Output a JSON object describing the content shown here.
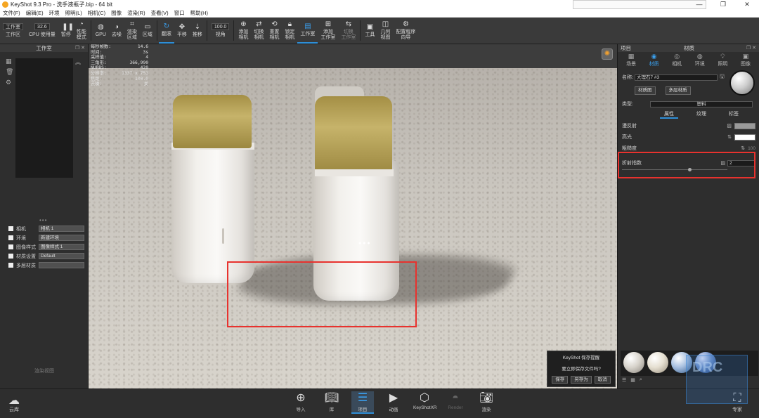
{
  "titlebar": {
    "title": "KeyShot 9.3 Pro - 洗手液瓶子.bip - 64 bit",
    "minimize": "—",
    "maximize": "❐",
    "close": "✕"
  },
  "menu": [
    "文件(F)",
    "编辑(E)",
    "环境",
    "照明(L)",
    "相机(C)",
    "图像",
    "渲染(R)",
    "查看(V)",
    "窗口",
    "帮助(H)"
  ],
  "toolbar": {
    "workspace_value": "工作室",
    "workspace_label": "工作区",
    "cpu_value": "32.6",
    "cpu_label": "CPU 使用量",
    "pause": "暂停",
    "perf_mode": "性能\n模式",
    "gpu": "GPU",
    "denoise": "去噪",
    "render_region": "渲染\n区域",
    "region": "区域",
    "tumble": "翻滚",
    "pan": "平移",
    "dolly": "推移",
    "fov_value": "100.0",
    "fov_label": "视角",
    "add_camera": "添加\n相机",
    "switch_camera": "切换\n相机",
    "reset_camera": "重置\n相机",
    "lock_camera": "锁定\n相机",
    "studio": "工作室",
    "add_studio": "添加\n工作室",
    "switch_studio": "切换\n工作室",
    "tools": "工具",
    "geometry_view": "几何\n视图",
    "config_wizard": "配置程序\n向导"
  },
  "left_panel": {
    "title": "工作室",
    "rows": [
      {
        "label": "相机",
        "value": "相机 1"
      },
      {
        "label": "环境",
        "value": "新建环境"
      },
      {
        "label": "图像样式",
        "value": "图像样式 1"
      },
      {
        "label": "材质设置",
        "value": "Default"
      },
      {
        "label": "多层材质",
        "value": ""
      }
    ],
    "footer": "渲染视图"
  },
  "stats": [
    {
      "k": "每秒帧数:",
      "v": "14.6"
    },
    {
      "k": "时间:",
      "v": "3s"
    },
    {
      "k": "采样值:",
      "v": "4"
    },
    {
      "k": "三角形:",
      "v": "366,990"
    },
    {
      "k": "NURBS:",
      "v": "420"
    },
    {
      "k": "分辨率:",
      "v": "1337 x 753"
    },
    {
      "k": "焦距:",
      "v": "100.0"
    },
    {
      "k": "去噪:",
      "v": "关"
    }
  ],
  "dialog": {
    "title": "KeyShot 保存提醒",
    "message": "要立即保存文件吗?",
    "save": "保存",
    "save_as": "另存为",
    "cancel": "取消"
  },
  "right_panel": {
    "project_label": "项目",
    "material_label": "材质",
    "tabs": [
      {
        "label": "场景",
        "icon": "scene-icon"
      },
      {
        "label": "材质",
        "icon": "material-icon"
      },
      {
        "label": "相机",
        "icon": "camera-icon"
      },
      {
        "label": "环境",
        "icon": "environment-icon"
      },
      {
        "label": "照明",
        "icon": "lighting-icon"
      },
      {
        "label": "图像",
        "icon": "image-icon"
      }
    ],
    "name_label": "名称:",
    "name_value": "大理石7 #3",
    "material_graph": "材质图",
    "multi_material": "多层材质",
    "type_label": "类型:",
    "type_value": "塑料",
    "subtabs": [
      "属性",
      "纹理",
      "标签"
    ],
    "props": [
      {
        "label": "漫反射",
        "color": "#9a9a9a"
      },
      {
        "label": "高光",
        "color": "#ffffff"
      },
      {
        "label": "粗糙度",
        "value": "100"
      }
    ],
    "ior_label": "折射指数",
    "ior_value": "2"
  },
  "bottom": {
    "cloud": "云库",
    "items": [
      "导入",
      "库",
      "项目",
      "动画",
      "KeyShotXR",
      "Render",
      "渲染"
    ],
    "expert": "专家"
  },
  "watermark": "DRC"
}
